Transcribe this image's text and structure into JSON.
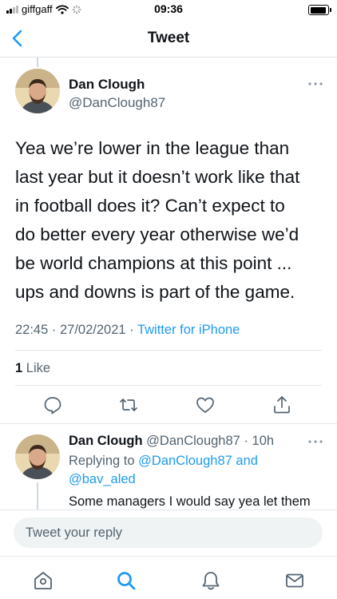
{
  "status_bar": {
    "carrier": "giffgaff",
    "time": "09:36"
  },
  "nav": {
    "title": "Tweet",
    "back_icon": "chevron-left-icon"
  },
  "main_tweet": {
    "author_name": "Dan Clough",
    "handle": "@DanClough87",
    "text": "Yea we’re lower in the league than\nlast year but it doesn’t work like that\nin football does it? Can’t expect to\ndo better every year otherwise we’d\nbe world champions at this point ...\nups and downs is part of the game.",
    "time": "22:45",
    "separator": "·",
    "date": "27/02/2021",
    "source": "Twitter for iPhone",
    "like_count": "1",
    "like_label": "Like"
  },
  "reply_tweet": {
    "author_name": "Dan Clough",
    "handle": "@DanClough87",
    "age": "10h",
    "replying_prefix": "Replying to",
    "replying_user1": "@DanClough87",
    "replying_and": "and",
    "replying_user2": "@bav_aled",
    "text": "Some managers I would say yea let them"
  },
  "composer": {
    "placeholder": "Tweet your reply"
  },
  "tab_bar": {
    "items": [
      "home-icon",
      "search-icon",
      "notifications-icon",
      "messages-icon"
    ]
  },
  "colors": {
    "accent": "#1d9bf0",
    "secondary_text": "#536471",
    "primary_text": "#0f1419",
    "divider": "#e1e8ed"
  }
}
